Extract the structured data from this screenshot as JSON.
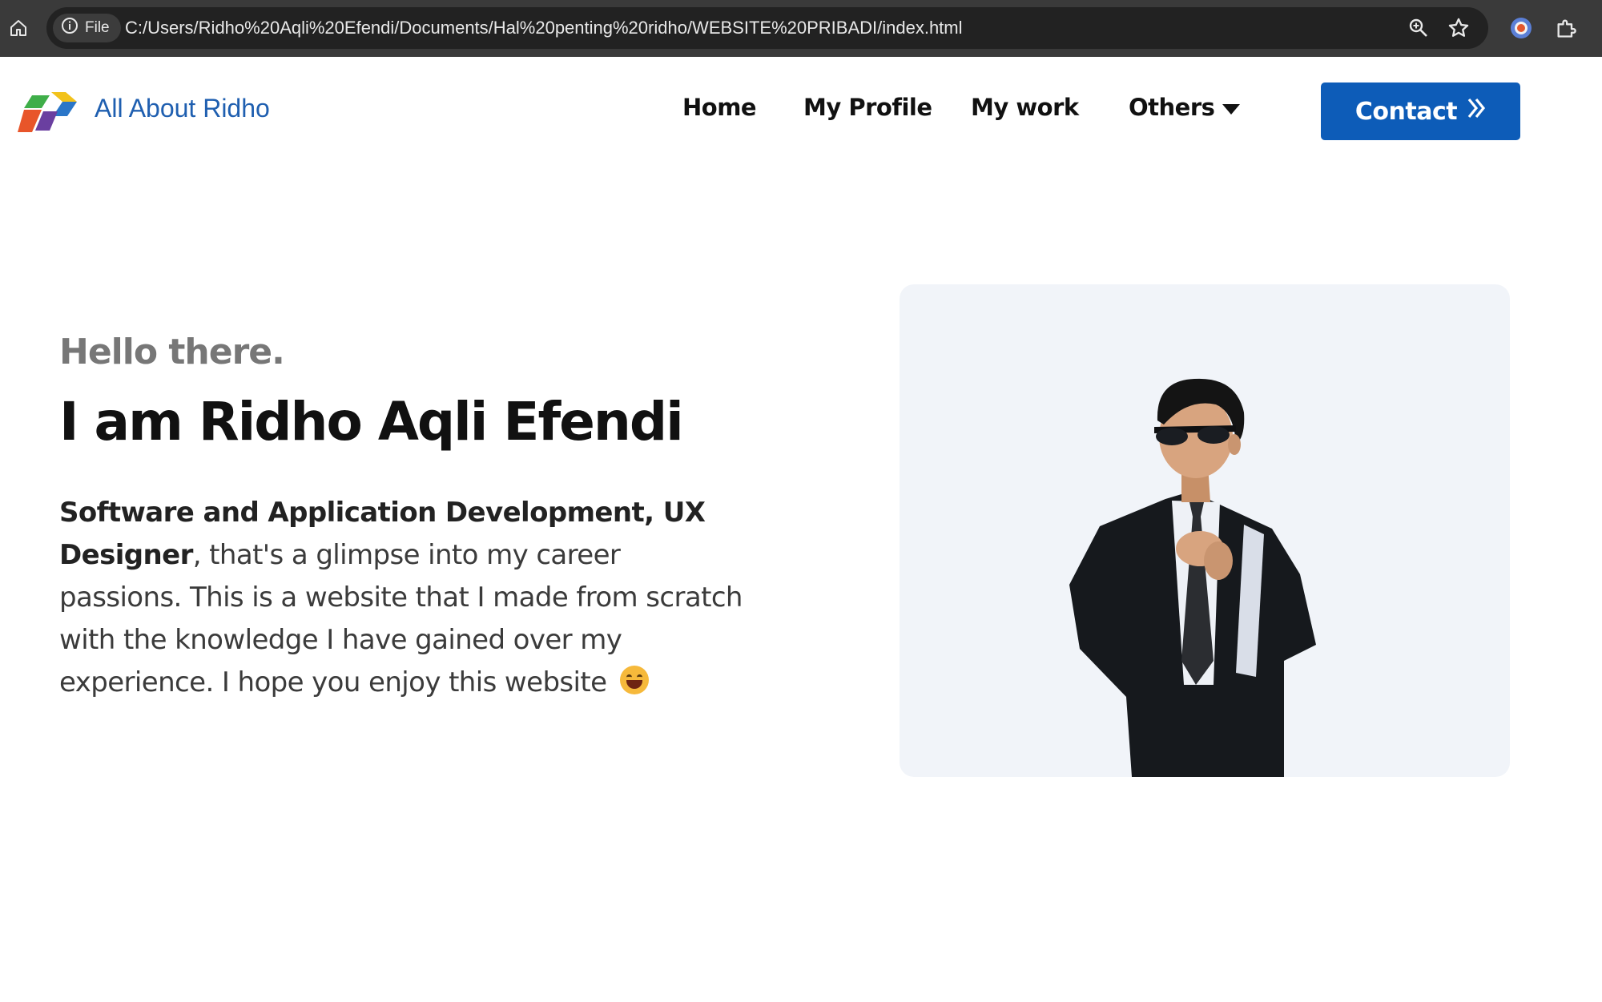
{
  "browser": {
    "site_chip_label": "File",
    "url": "C:/Users/Ridho%20Aqli%20Efendi/Documents/Hal%20penting%20ridho/WEBSITE%20PRIBADI/index.html",
    "icons": [
      "home-icon",
      "info-icon",
      "zoom-icon",
      "star-icon",
      "profile-icon",
      "extensions-icon"
    ]
  },
  "navbar": {
    "brand": "All About Ridho",
    "links": [
      "Home",
      "My Profile",
      "My work",
      "Others"
    ],
    "contact_label": "Contact",
    "accent_color": "#0d5cb8"
  },
  "hero": {
    "greeting": "Hello there.",
    "name": "I am Ridho Aqli Efendi",
    "desc_bold": "Software and Application Development, UX Designer",
    "desc_rest": ", that's a glimpse into my career passions. This is a website that I made from scratch with the knowledge I have gained over my experience. I hope you enjoy this website",
    "emoji": "grinning-face-emoji",
    "photo": "portrait-photo"
  }
}
